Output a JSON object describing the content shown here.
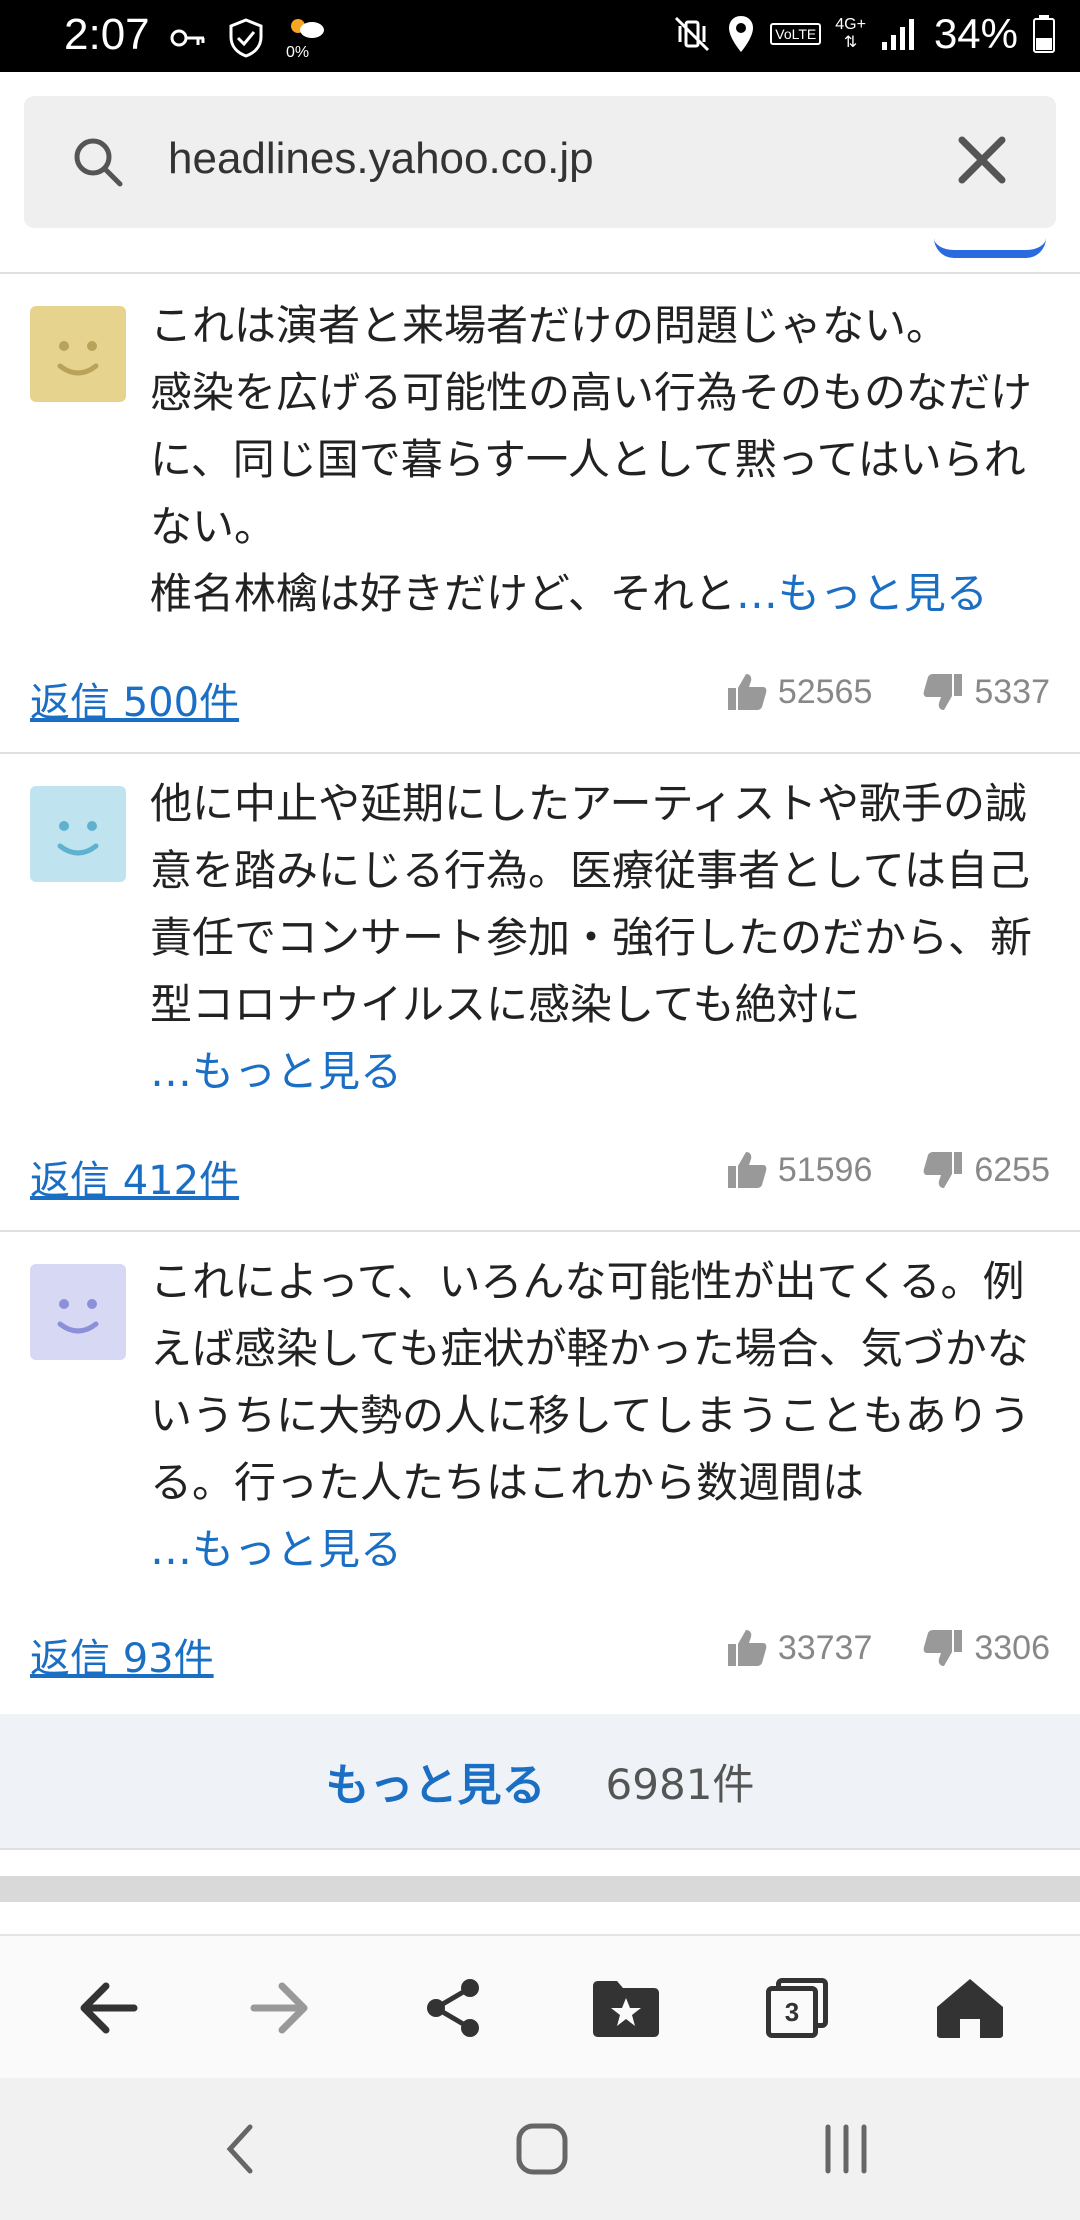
{
  "status_bar": {
    "time": "2:07",
    "weather_percent": "0%",
    "network_type": "4G+",
    "volte": "VoLTE",
    "battery": "34%"
  },
  "url_bar": {
    "url": "headlines.yahoo.co.jp"
  },
  "comments": [
    {
      "avatar_color": "#e6d48e",
      "avatar_face_color": "#b9a35a",
      "text": "これは演者と来場者だけの問題じゃない。\n感染を広げる可能性の高い行為そのものなだけに、同じ国で暮らす一人として黙ってはいられない。\n椎名林檎は好きだけど、それと",
      "more": "…もっと見る",
      "replies": "返信 500件",
      "likes": "52565",
      "dislikes": "5337"
    },
    {
      "avatar_color": "#bfe4f0",
      "avatar_face_color": "#5fb2cf",
      "text": "他に中止や延期にしたアーティストや歌手の誠意を踏みにじる行為。医療従事者としては自己責任でコンサート参加・強行したのだから、新型コロナウイルスに感染しても絶対に",
      "more": "…もっと見る",
      "replies": "返信 412件",
      "likes": "51596",
      "dislikes": "6255"
    },
    {
      "avatar_color": "#d6d8f4",
      "avatar_face_color": "#8b90d8",
      "text": "これによって、いろんな可能性が出てくる。例えば感染しても症状が軽かった場合、気づかないうちに大勢の人に移してしまうこともありうる。行った人たちはこれから数週間は",
      "more": "…もっと見る",
      "replies": "返信 93件",
      "likes": "33737",
      "dislikes": "3306"
    }
  ],
  "more_bar": {
    "label": "もっと見る",
    "count": "6981件"
  },
  "toolbar": {
    "tabs_count": "3"
  },
  "colors": {
    "accent": "#1a6fc4"
  }
}
